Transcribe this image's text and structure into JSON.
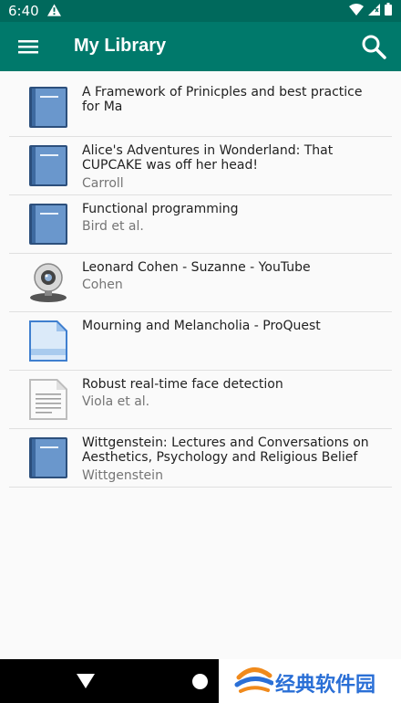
{
  "status": {
    "time": "6:40",
    "icons": [
      "warning-icon",
      "wifi-icon",
      "signal-icon",
      "battery-icon"
    ]
  },
  "app_bar": {
    "title": "My Library",
    "menu_icon": "menu-icon",
    "search_icon": "search-icon",
    "color": "#00796b"
  },
  "items": [
    {
      "title": "A Framework of Prinicples and best practice for Ma",
      "subtitle": "",
      "icon": "book-icon"
    },
    {
      "title": "Alice's Adventures in Wonderland: That CUPCAKE was off her head!",
      "subtitle": "Carroll",
      "icon": "book-icon"
    },
    {
      "title": "Functional programming",
      "subtitle": "Bird et al.",
      "icon": "book-icon"
    },
    {
      "title": "Leonard Cohen - Suzanne - YouTube",
      "subtitle": "Cohen",
      "icon": "webcam-icon"
    },
    {
      "title": "Mourning and Melancholia - ProQuest",
      "subtitle": "",
      "icon": "webpage-icon"
    },
    {
      "title": "Robust real-time face detection",
      "subtitle": "Viola et al.",
      "icon": "document-icon"
    },
    {
      "title": "Wittgenstein: Lectures and Conversations on Aesthetics, Psychology and Religious Belief",
      "subtitle": "Wittgenstein",
      "icon": "book-icon"
    }
  ],
  "nav": {
    "back_icon": "back-icon",
    "home_icon": "home-icon"
  },
  "watermark": {
    "text": "经典软件园",
    "logo": "watermark-logo"
  }
}
